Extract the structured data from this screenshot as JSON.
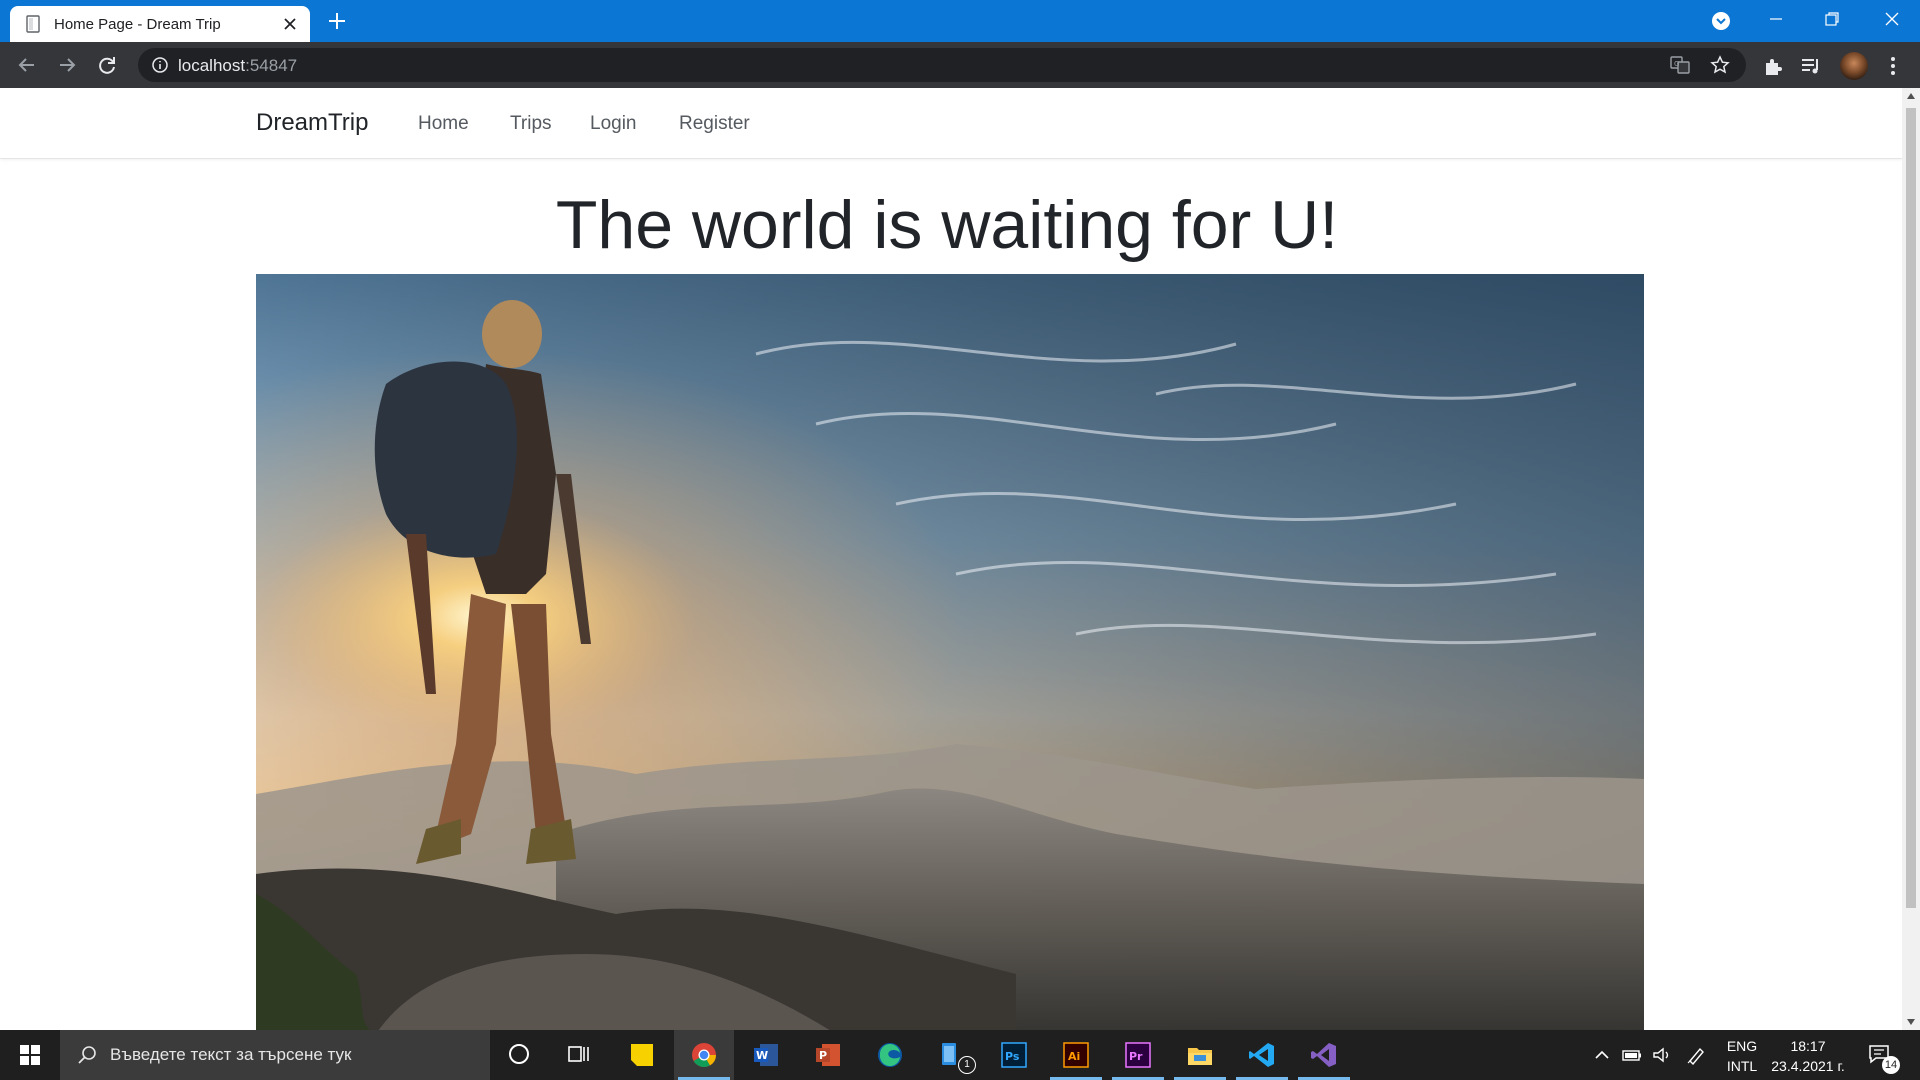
{
  "browser": {
    "tab_title": "Home Page - Dream Trip",
    "url_host": "localhost",
    "url_port": ":54847"
  },
  "site": {
    "brand": "DreamTrip",
    "nav": [
      "Home",
      "Trips",
      "Login",
      "Register"
    ],
    "hero_title": "The world is waiting for U!"
  },
  "taskbar": {
    "search_placeholder": "Въведете текст за търсене тук",
    "apps": [
      "task-view",
      "sticky-notes",
      "chrome",
      "word",
      "powerpoint",
      "edge",
      "files",
      "photoshop",
      "illustrator",
      "premiere",
      "file-explorer",
      "vs-code",
      "visual-studio"
    ],
    "files_badge": "1",
    "language_line1": "ENG",
    "language_line2": "INTL",
    "time": "18:17",
    "date": "23.4.2021 г.",
    "notifications": "14"
  },
  "colors": {
    "tabbar": "#0b76d4",
    "toolbar": "#35363a",
    "taskbar": "#1f1f1f",
    "text": "#212529"
  }
}
